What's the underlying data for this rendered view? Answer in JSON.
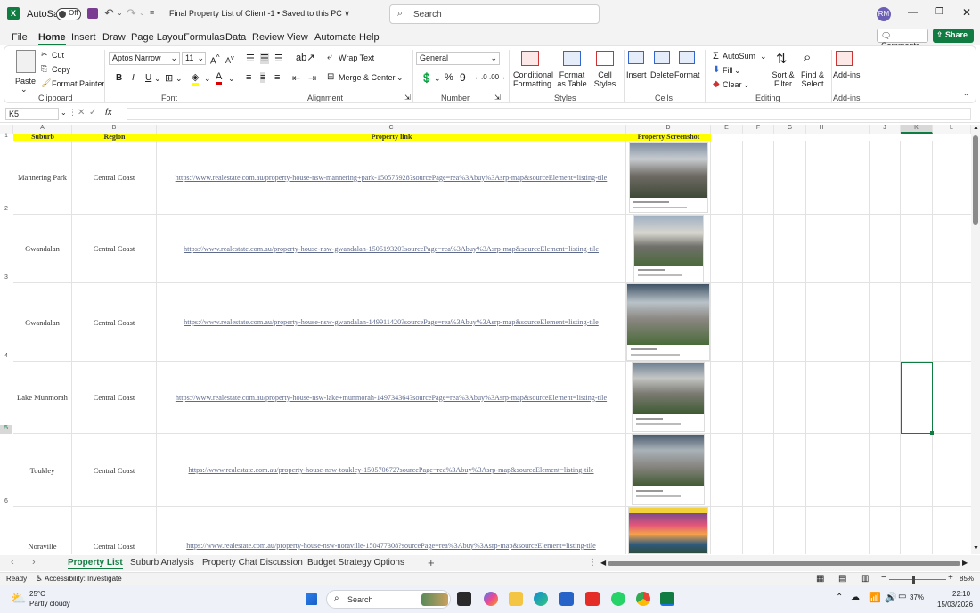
{
  "titlebar": {
    "autosave_label": "AutoSave",
    "autosave_state": "Off",
    "doc_title": "Final Property List of Client -1 • Saved to this PC ∨",
    "search_placeholder": "Search",
    "avatar_initials": "RM"
  },
  "menu": {
    "items": [
      "File",
      "Home",
      "Insert",
      "Draw",
      "Page Layout",
      "Formulas",
      "Data",
      "Review",
      "View",
      "Automate",
      "Help"
    ],
    "comments_label": "Comments",
    "share_label": "Share"
  },
  "ribbon": {
    "paste_label": "Paste",
    "cut_label": "Cut",
    "copy_label": "Copy",
    "format_painter_label": "Format Painter",
    "clipboard_group": "Clipboard",
    "font_name": "Aptos Narrow",
    "font_size": "11",
    "font_group": "Font",
    "wrap_text_label": "Wrap Text",
    "merge_center_label": "Merge & Center",
    "alignment_group": "Alignment",
    "number_format": "General",
    "number_group": "Number",
    "conditional_formatting_label": "Conditional Formatting",
    "format_as_table_label": "Format as Table",
    "cell_styles_label": "Cell Styles",
    "styles_group": "Styles",
    "insert_label": "Insert",
    "delete_label": "Delete",
    "format_label": "Format",
    "cells_group": "Cells",
    "autosum_label": "AutoSum",
    "fill_label": "Fill",
    "clear_label": "Clear",
    "sort_filter_label": "Sort & Filter",
    "find_select_label": "Find & Select",
    "editing_group": "Editing",
    "addins_label": "Add-ins",
    "addins_group": "Add-ins"
  },
  "formula_bar": {
    "name_box": "K5",
    "fx": "fx",
    "value": ""
  },
  "columns": [
    "A",
    "B",
    "C",
    "D",
    "E",
    "F",
    "G",
    "H",
    "I",
    "J",
    "K",
    "L"
  ],
  "row_numbers": [
    "1",
    "2",
    "3",
    "4",
    "5",
    "6"
  ],
  "headers": {
    "suburb": "Suburb",
    "region": "Region",
    "link": "Property link",
    "screenshot": "Property Screenshot"
  },
  "rows": [
    {
      "suburb": "Mannering Park",
      "region": "Central Coast",
      "link": "https://www.realestate.com.au/property-house-nsw-mannering+park-150575928?sourcePage=rea%3Abuy%3Asrp-map&sourceElement=listing-tile"
    },
    {
      "suburb": "Gwandalan",
      "region": "Central Coast",
      "link": "https://www.realestate.com.au/property-house-nsw-gwandalan-150519320?sourcePage=rea%3Abuy%3Asrp-map&sourceElement=listing-tile"
    },
    {
      "suburb": "Gwandalan",
      "region": "Central Coast",
      "link": "https://www.realestate.com.au/property-house-nsw-gwandalan-149911420?sourcePage=rea%3Abuy%3Asrp-map&sourceElement=listing-tile"
    },
    {
      "suburb": "Lake Munmorah",
      "region": "Central Coast",
      "link": "https://www.realestate.com.au/property-house-nsw-lake+munmorah-149734364?sourcePage=rea%3Abuy%3Asrp-map&sourceElement=listing-tile"
    },
    {
      "suburb": "Toukley",
      "region": "Central Coast",
      "link": "https://www.realestate.com.au/property-house-nsw-toukley-150570672?sourcePage=rea%3Abuy%3Asrp-map&sourceElement=listing-tile"
    },
    {
      "suburb": "Noraville",
      "region": "Central Coast",
      "link": "https://www.realestate.com.au/property-house-nsw-noraville-150477308?sourcePage=rea%3Abuy%3Asrp-map&sourceElement=listing-tile"
    }
  ],
  "sheet_tabs": [
    "Property List",
    "Suburb Analysis",
    "Property Chat Discussion",
    "Budget Strategy Options"
  ],
  "status": {
    "ready": "Ready",
    "accessibility": "Accessibility: Investigate",
    "zoom": "85%"
  },
  "taskbar": {
    "temperature": "25°C",
    "weather": "Partly cloudy",
    "search_label": "Search",
    "battery": "37%",
    "time": "22:10",
    "date": "15/03/2026"
  },
  "colors": {
    "excel_green": "#107c41",
    "header_yellow": "#ffff00"
  }
}
